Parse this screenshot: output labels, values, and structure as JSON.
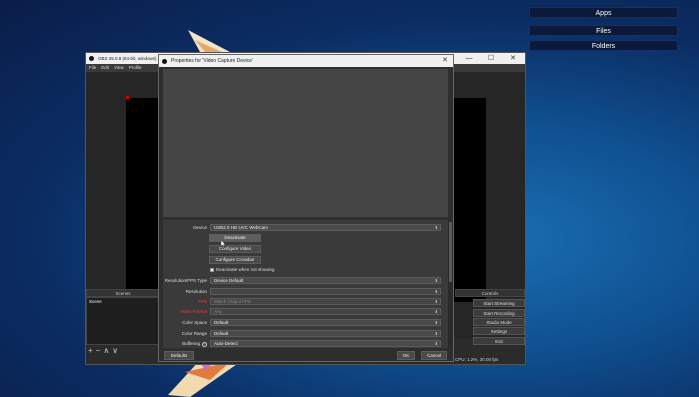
{
  "desktop": {
    "buttons": [
      "Apps",
      "Files",
      "Folders"
    ]
  },
  "obs_window": {
    "title": "OBS 25.0.8 (64-bit, windows)",
    "menu": [
      "File",
      "Edit",
      "View",
      "Profile"
    ],
    "docks": {
      "scenes_header": "Scenes",
      "controls_header": "Controls"
    },
    "scenes": [
      "Scene"
    ],
    "scene_tools": [
      "+",
      "−",
      "∧",
      "∨"
    ],
    "controls": [
      "Start Streaming",
      "Start Recording",
      "Studio Mode",
      "Settings",
      "Exit"
    ],
    "status": "CPU: 1.2%, 30.00 fps",
    "window_controls": [
      "—",
      "☐",
      "✕"
    ]
  },
  "dialog": {
    "title": "Properties for 'Video Capture Device'",
    "close": "✕",
    "properties": {
      "device_label": "Device",
      "device_value": "USB2.0 HD UVC WebCam",
      "deactivate_btn": "Deactivate",
      "configure_video_btn": "Configure Video",
      "configure_crossbar_btn": "Configure Crossbar",
      "deactivate_check": "Deactivate when not showing",
      "res_type_label": "Resolution/FPS Type",
      "res_type_value": "Device Default",
      "resolution_label": "Resolution",
      "resolution_value": "",
      "fps_label": "FPS",
      "fps_value": "Match Output FPS",
      "video_format_label": "Video Format",
      "video_format_value": "Any",
      "color_space_label": "Color Space",
      "color_space_value": "Default",
      "color_range_label": "Color Range",
      "color_range_value": "Default",
      "buffering_label": "Buffering",
      "buffering_value": "Auto-Detect"
    },
    "defaults_btn": "Defaults",
    "ok_btn": "OK",
    "cancel_btn": "Cancel"
  }
}
